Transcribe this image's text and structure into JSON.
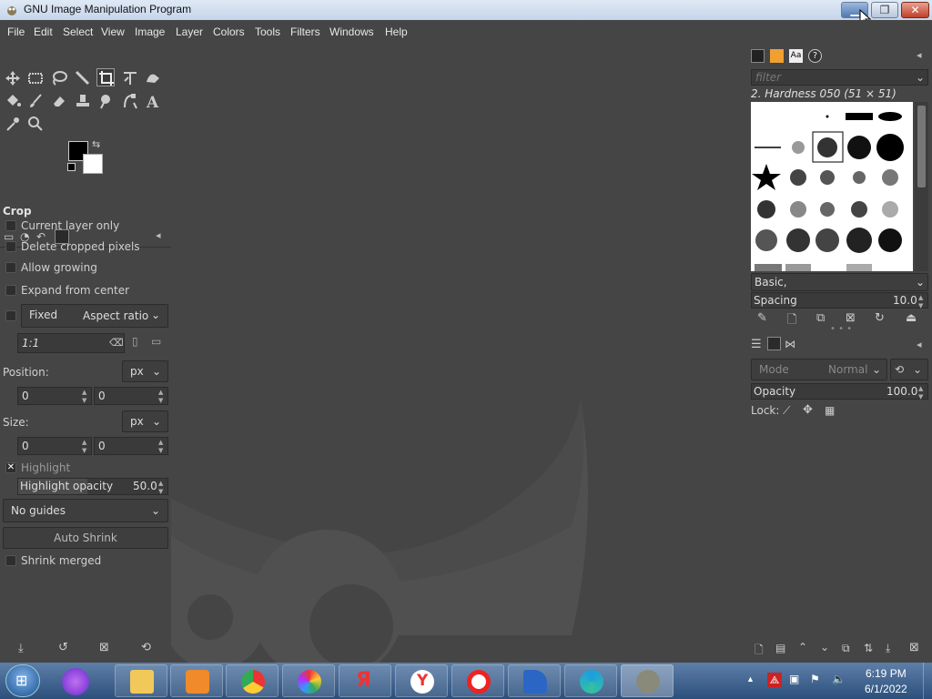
{
  "window": {
    "title": "GNU Image Manipulation Program"
  },
  "menu": [
    "File",
    "Edit",
    "Select",
    "View",
    "Image",
    "Layer",
    "Colors",
    "Tools",
    "Filters",
    "Windows",
    "Help"
  ],
  "tool_options": {
    "tool_name": "Crop",
    "current_layer_only": "Current layer only",
    "delete_cropped_pixels": "Delete cropped pixels",
    "allow_growing": "Allow growing",
    "expand_from_center": "Expand from center",
    "fixed_label": "Fixed",
    "fixed_mode": "Aspect ratio",
    "ratio_value": "1:1",
    "position_label": "Position:",
    "position_unit": "px",
    "position_x": "0",
    "position_y": "0",
    "size_label": "Size:",
    "size_unit": "px",
    "size_w": "0",
    "size_h": "0",
    "highlight_label": "Highlight",
    "highlight_opacity_label": "Highlight opacity",
    "highlight_opacity_value": "50.0",
    "guides": "No guides",
    "auto_shrink": "Auto Shrink",
    "shrink_merged": "Shrink merged"
  },
  "brushes": {
    "filter_placeholder": "filter",
    "selected_brush": "2. Hardness 050 (51 × 51)",
    "tag": "Basic,",
    "spacing_label": "Spacing",
    "spacing_value": "10.0"
  },
  "layers": {
    "mode_label": "Mode",
    "mode_value": "Normal",
    "opacity_label": "Opacity",
    "opacity_value": "100.0",
    "lock_label": "Lock:"
  },
  "taskbar": {
    "time": "6:19 PM",
    "date": "6/1/2022",
    "apps": [
      "alice",
      "file-explorer",
      "media-player",
      "chrome",
      "photos",
      "yandex-browser",
      "yandex",
      "opera",
      "app-blue",
      "edge",
      "gimp"
    ]
  },
  "colors": {
    "panel_bg": "#454545",
    "taskbar": "#2c4f7c"
  }
}
